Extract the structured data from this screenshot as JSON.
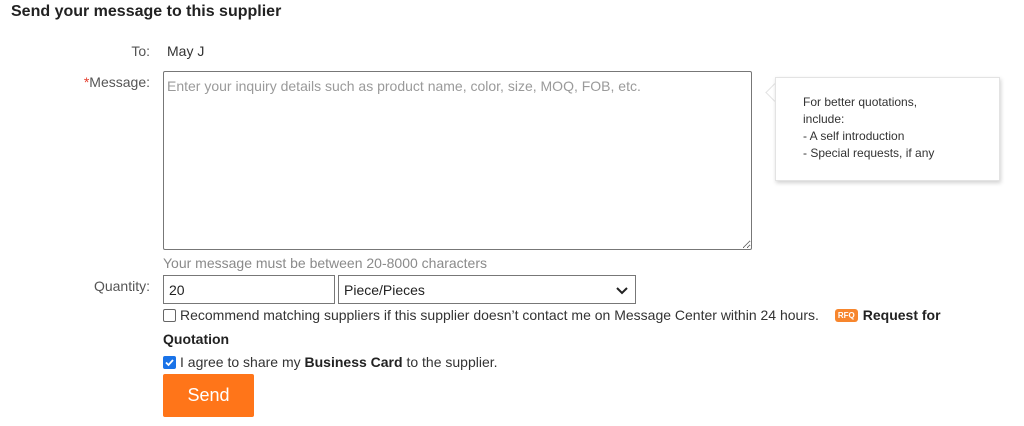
{
  "form": {
    "title": "Send your message to this supplier",
    "to_label": "To:",
    "to_value": "May J",
    "message_required_mark": "*",
    "message_label": "Message:",
    "message_placeholder": "Enter your inquiry details such as product name, color, size, MOQ, FOB, etc.",
    "message_hint": "Your message must be between 20-8000 characters",
    "tip": {
      "line1": "For better quotations,",
      "line2": "include:",
      "line3": "- A self introduction",
      "line4": "- Special requests, if any"
    },
    "quantity_label": "Quantity:",
    "quantity_value": "20",
    "unit_selected": "Piece/Pieces",
    "recommend_text": "Recommend matching suppliers if this supplier doesn’t contact me on Message Center within 24 hours.",
    "recommend_checked": false,
    "rfq_badge": "RFQ",
    "rfq_link_part1": "Request for",
    "rfq_link_part2": "Quotation",
    "agree_prefix": "I agree to share my ",
    "agree_bold": "Business Card",
    "agree_suffix": " to the supplier.",
    "agree_checked": true,
    "send_label": "Send"
  },
  "colors": {
    "accent": "#ff7519",
    "checkbox": "#1a73e8",
    "required": "#e53e2e"
  }
}
